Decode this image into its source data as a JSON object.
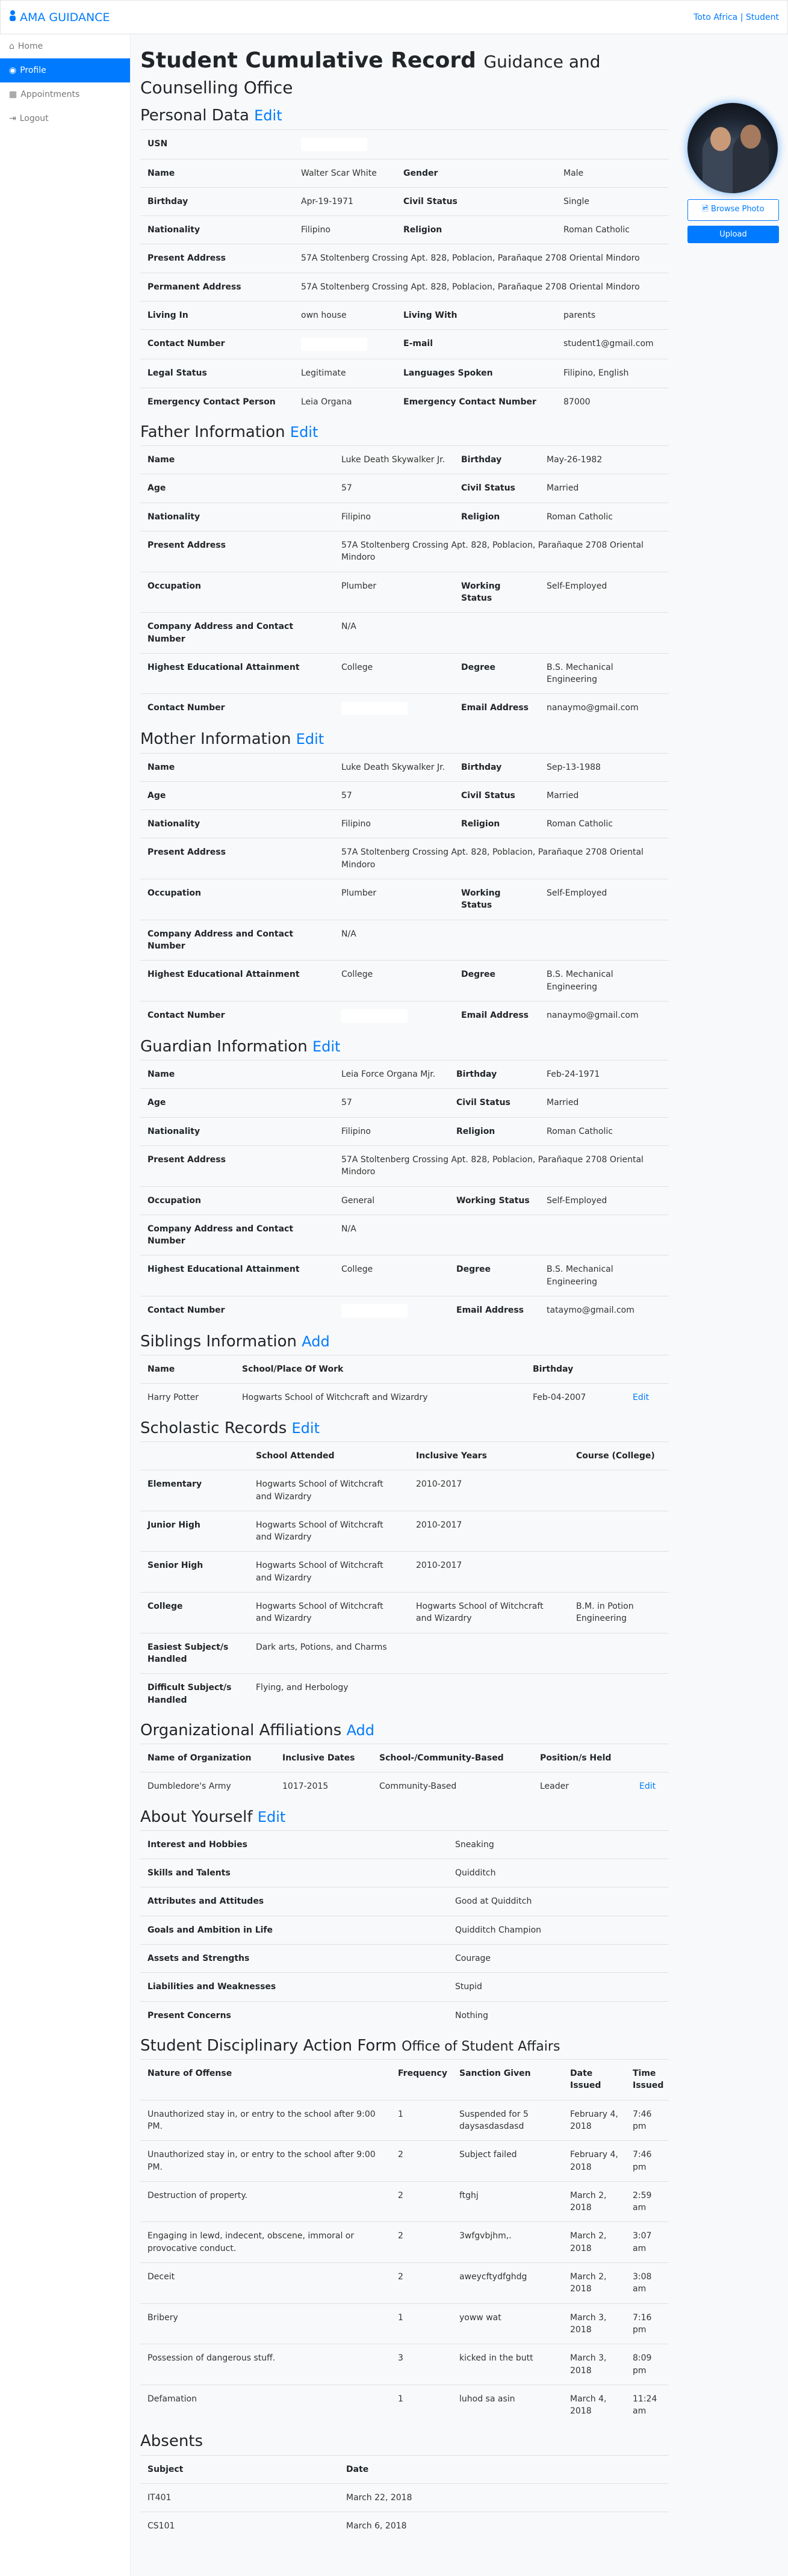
{
  "header": {
    "brand": "AMA GUIDANCE",
    "user": "Toto Africa | Student"
  },
  "sidebar": {
    "items": [
      {
        "label": "Home",
        "icon": "home-icon"
      },
      {
        "label": "Profile",
        "icon": "user-circle-icon",
        "active": true
      },
      {
        "label": "Appointments",
        "icon": "calendar-icon"
      },
      {
        "label": "Logout",
        "icon": "logout-icon"
      }
    ]
  },
  "page": {
    "title": "Student Cumulative Record",
    "subtitle": "Guidance and Counselling Office"
  },
  "photo": {
    "browse": "Browse Photo",
    "upload": "Upload"
  },
  "sections": [
    {
      "id": "personal",
      "title": "Personal Data",
      "action": "Edit",
      "type": "kv",
      "cols": [
        255,
        170,
        266,
        187
      ],
      "rows": [
        [
          "USN",
          null
        ],
        [
          "Name",
          "Walter Scar White",
          "Gender",
          "Male"
        ],
        [
          "Birthday",
          "Apr-19-1971",
          "Civil Status",
          "Single"
        ],
        [
          "Nationality",
          "Filipino",
          "Religion",
          "Roman Catholic"
        ],
        [
          "Present Address",
          "57A Stoltenberg Crossing Apt. 828, Poblacion, Parañaque 2708 Oriental Mindoro"
        ],
        [
          "Permanent Address",
          "57A Stoltenberg Crossing Apt. 828, Poblacion, Parañaque 2708 Oriental Mindoro"
        ],
        [
          "Living In",
          "own house",
          "Living With",
          "parents"
        ],
        [
          "Contact Number",
          null,
          "E-mail",
          "student1@gmail.com"
        ],
        [
          "Legal Status",
          "Legitimate",
          "Languages Spoken",
          "Filipino, English"
        ],
        [
          "Emergency Contact Person",
          "Leia Organa",
          "Emergency Contact Number",
          "87000"
        ]
      ]
    },
    {
      "id": "father",
      "title": "Father Information",
      "action": "Edit",
      "type": "kv",
      "cols": [
        322,
        199,
        142,
        215
      ],
      "rows": [
        [
          "Name",
          "Luke Death Skywalker Jr.",
          "Birthday",
          "May-26-1982"
        ],
        [
          "Age",
          "57",
          "Civil Status",
          "Married"
        ],
        [
          "Nationality",
          "Filipino",
          "Religion",
          "Roman Catholic"
        ],
        [
          "Present Address",
          "57A Stoltenberg Crossing Apt. 828, Poblacion, Parañaque 2708 Oriental Mindoro"
        ],
        [
          "Occupation",
          "Plumber",
          "Working Status",
          "Self-Employed"
        ],
        [
          "Company Address and Contact Number",
          "N/A"
        ],
        [
          "Highest Educational Attainment",
          "College",
          "Degree",
          "B.S. Mechanical Engineering"
        ],
        [
          "Contact Number",
          null,
          "Email Address",
          "nanaymo@gmail.com"
        ]
      ]
    },
    {
      "id": "mother",
      "title": "Mother Information",
      "action": "Edit",
      "type": "kv",
      "cols": [
        322,
        199,
        142,
        215
      ],
      "rows": [
        [
          "Name",
          "Luke Death Skywalker Jr.",
          "Birthday",
          "Sep-13-1988"
        ],
        [
          "Age",
          "57",
          "Civil Status",
          "Married"
        ],
        [
          "Nationality",
          "Filipino",
          "Religion",
          "Roman Catholic"
        ],
        [
          "Present Address",
          "57A Stoltenberg Crossing Apt. 828, Poblacion, Parañaque 2708 Oriental Mindoro"
        ],
        [
          "Occupation",
          "Plumber",
          "Working Status",
          "Self-Employed"
        ],
        [
          "Company Address and Contact Number",
          "N/A"
        ],
        [
          "Highest Educational Attainment",
          "College",
          "Degree",
          "B.S. Mechanical Engineering"
        ],
        [
          "Contact Number",
          null,
          "Email Address",
          "nanaymo@gmail.com"
        ]
      ]
    },
    {
      "id": "guardian",
      "title": "Guardian Information",
      "action": "Edit",
      "type": "kv",
      "cols": [
        322,
        191,
        150,
        215
      ],
      "rows": [
        [
          "Name",
          "Leia Force Organa Mjr.",
          "Birthday",
          "Feb-24-1971"
        ],
        [
          "Age",
          "57",
          "Civil Status",
          "Married"
        ],
        [
          "Nationality",
          "Filipino",
          "Religion",
          "Roman Catholic"
        ],
        [
          "Present Address",
          "57A Stoltenberg Crossing Apt. 828, Poblacion, Parañaque 2708 Oriental Mindoro"
        ],
        [
          "Occupation",
          "General",
          "Working Status",
          "Self-Employed"
        ],
        [
          "Company Address and Contact Number",
          "N/A"
        ],
        [
          "Highest Educational Attainment",
          "College",
          "Degree",
          "B.S. Mechanical Engineering"
        ],
        [
          "Contact Number",
          null,
          "Email Address",
          "tataymo@gmail.com"
        ]
      ]
    },
    {
      "id": "siblings",
      "title": "Siblings Information",
      "action": "Add",
      "type": "grid",
      "cols": [
        157,
        483,
        166,
        72
      ],
      "headers": [
        "Name",
        "School/Place Of Work",
        "Birthday",
        ""
      ],
      "rowLink": "Edit",
      "rows": [
        [
          "Harry Potter",
          "Hogwarts School of Witchcraft and Wizardry",
          "Feb-04-2007"
        ]
      ]
    },
    {
      "id": "scholastic",
      "title": "Scholastic Records",
      "action": "Edit",
      "type": "grid",
      "firstBold": true,
      "cols": [
        180,
        266,
        266,
        166
      ],
      "headers": [
        "",
        "School Attended",
        "Inclusive Years",
        "Course (College)"
      ],
      "rows": [
        [
          "Elementary",
          "Hogwarts School of Witchcraft and Wizardry",
          "2010-2017",
          ""
        ],
        [
          "Junior High",
          "Hogwarts School of Witchcraft and Wizardry",
          "2010-2017",
          ""
        ],
        [
          "Senior High",
          "Hogwarts School of Witchcraft and Wizardry",
          "2010-2017",
          ""
        ],
        [
          "College",
          "Hogwarts School of Witchcraft and Wizardry",
          "Hogwarts School of Witchcraft and Wizardry",
          "B.M. in Potion Engineering"
        ],
        [
          "Easiest Subject/s Handled",
          "Dark arts, Potions, and Charms",
          "",
          ""
        ],
        [
          "Difficult Subject/s Handled",
          "Flying, and Herbology",
          "",
          ""
        ]
      ]
    },
    {
      "id": "affiliations",
      "title": "Organizational Affiliations",
      "action": "Add",
      "type": "grid",
      "cols": [
        224,
        161,
        267,
        165,
        61
      ],
      "headers": [
        "Name of Organization",
        "Inclusive Dates",
        "School-/Community-Based",
        "Position/s Held",
        ""
      ],
      "rowLink": "Edit",
      "rows": [
        [
          "Dumbledore's Army",
          "1017-2015",
          "Community-Based",
          "Leader"
        ]
      ]
    },
    {
      "id": "about",
      "title": "About Yourself",
      "action": "Edit",
      "type": "grid",
      "firstBold": true,
      "noHeader": true,
      "cols": [
        511,
        367
      ],
      "rows": [
        [
          "Interest and Hobbies",
          "Sneaking"
        ],
        [
          "Skills and Talents",
          "Quidditch"
        ],
        [
          "Attributes and Attitudes",
          "Good at Quidditch"
        ],
        [
          "Goals and Ambition in Life",
          "Quidditch Champion"
        ],
        [
          "Assets and Strengths",
          "Courage"
        ],
        [
          "Liabilities and Weaknesses",
          "Stupid"
        ],
        [
          "Present Concerns",
          "Nothing"
        ]
      ]
    },
    {
      "id": "disciplinary",
      "title": "Student Disciplinary Action Form",
      "subtitle": "Office of Student Affairs",
      "type": "grid",
      "cols": [
        416,
        102,
        184,
        104,
        72
      ],
      "headers": [
        "Nature of Offense",
        "Frequency",
        "Sanction Given",
        "Date Issued",
        "Time Issued"
      ],
      "rows": [
        [
          "Unauthorized stay in, or entry to the school after 9:00 PM.",
          "1",
          "Suspended for 5 daysasdasdasd",
          "February 4, 2018",
          "7:46 pm"
        ],
        [
          "Unauthorized stay in, or entry to the school after 9:00 PM.",
          "2",
          "Subject failed",
          "February 4, 2018",
          "7:46 pm"
        ],
        [
          "Destruction of property.",
          "2",
          "ftghj",
          "March 2, 2018",
          "2:59 am"
        ],
        [
          "Engaging in lewd, indecent, obscene, immoral or provocative conduct.",
          "2",
          "3wfgvbjhm,.",
          "March 2, 2018",
          "3:07 am"
        ],
        [
          "Deceit",
          "2",
          "aweycftydfghdg",
          "March 2, 2018",
          "3:08 am"
        ],
        [
          "Bribery",
          "1",
          "yoww wat",
          "March 3, 2018",
          "7:16 pm"
        ],
        [
          "Possession of dangerous stuff.",
          "3",
          "kicked in the butt",
          "March 3, 2018",
          "8:09 pm"
        ],
        [
          "Defamation",
          "1",
          "luhod sa asin",
          "March 4, 2018",
          "11:24 am"
        ]
      ]
    },
    {
      "id": "absents",
      "title": "Absents",
      "type": "grid",
      "cols": [
        330,
        548
      ],
      "headers": [
        "Subject",
        "Date"
      ],
      "rows": [
        [
          "IT401",
          "March 22, 2018"
        ],
        [
          "CS101",
          "March 6, 2018"
        ]
      ]
    }
  ]
}
